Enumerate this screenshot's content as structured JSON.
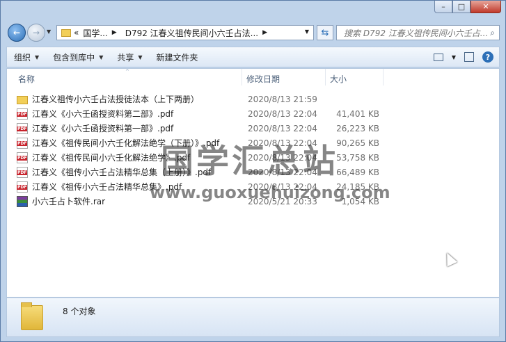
{
  "window": {
    "minimize": "–",
    "maximize": "□",
    "close": "✕"
  },
  "nav": {
    "back_glyph": "←",
    "forward_glyph": "→",
    "dropdown_glyph": "▼",
    "address_prefix": "«",
    "breadcrumb": [
      "国学...",
      "D792 江春义祖传民间小六壬占法..."
    ],
    "crumb_sep": "▶",
    "refresh_glyph": "⇆",
    "search_placeholder": "搜索 D792 江春义祖传民间小六壬占...",
    "search_glyph": "⌕"
  },
  "toolbar": {
    "organize": "组织",
    "include_in_library": "包含到库中",
    "share": "共享",
    "new_folder": "新建文件夹",
    "help": "?"
  },
  "columns": {
    "name": "名称",
    "modified": "修改日期",
    "size": "大小",
    "sort_glyph": "^"
  },
  "files": [
    {
      "type": "folder",
      "name": "江春义祖传小六壬占法授徒法本（上下两册）",
      "date": "2020/8/13 21:59",
      "size": ""
    },
    {
      "type": "pdf",
      "name": "江春义《小六壬函授资料第二部》.pdf",
      "date": "2020/8/13 22:04",
      "size": "41,401 KB"
    },
    {
      "type": "pdf",
      "name": "江春义《小六壬函授资料第一部》.pdf",
      "date": "2020/8/13 22:04",
      "size": "26,223 KB"
    },
    {
      "type": "pdf",
      "name": "江春义《祖传民间小六壬化解法绝学（下册）》.pdf",
      "date": "2020/8/13 22:04",
      "size": "90,265 KB"
    },
    {
      "type": "pdf",
      "name": "江春义《祖传民间小六壬化解法绝学》.pdf",
      "date": "2020/8/13 22:04",
      "size": "53,758 KB"
    },
    {
      "type": "pdf",
      "name": "江春义《祖传小六壬占法精华总集（上册）》.pdf",
      "date": "2020/8/13 22:04",
      "size": "66,489 KB"
    },
    {
      "type": "pdf",
      "name": "江春义《祖传小六壬占法精华总集》.pdf",
      "date": "2020/8/13 22:04",
      "size": "24,185 KB"
    },
    {
      "type": "rar",
      "name": "小六壬占卜软件.rar",
      "date": "2020/5/21 20:33",
      "size": "1,054 KB"
    }
  ],
  "watermark": {
    "title": "国学汇总站",
    "url": "www.guoxuehuizong.com"
  },
  "details": {
    "count": "8 个对象"
  }
}
